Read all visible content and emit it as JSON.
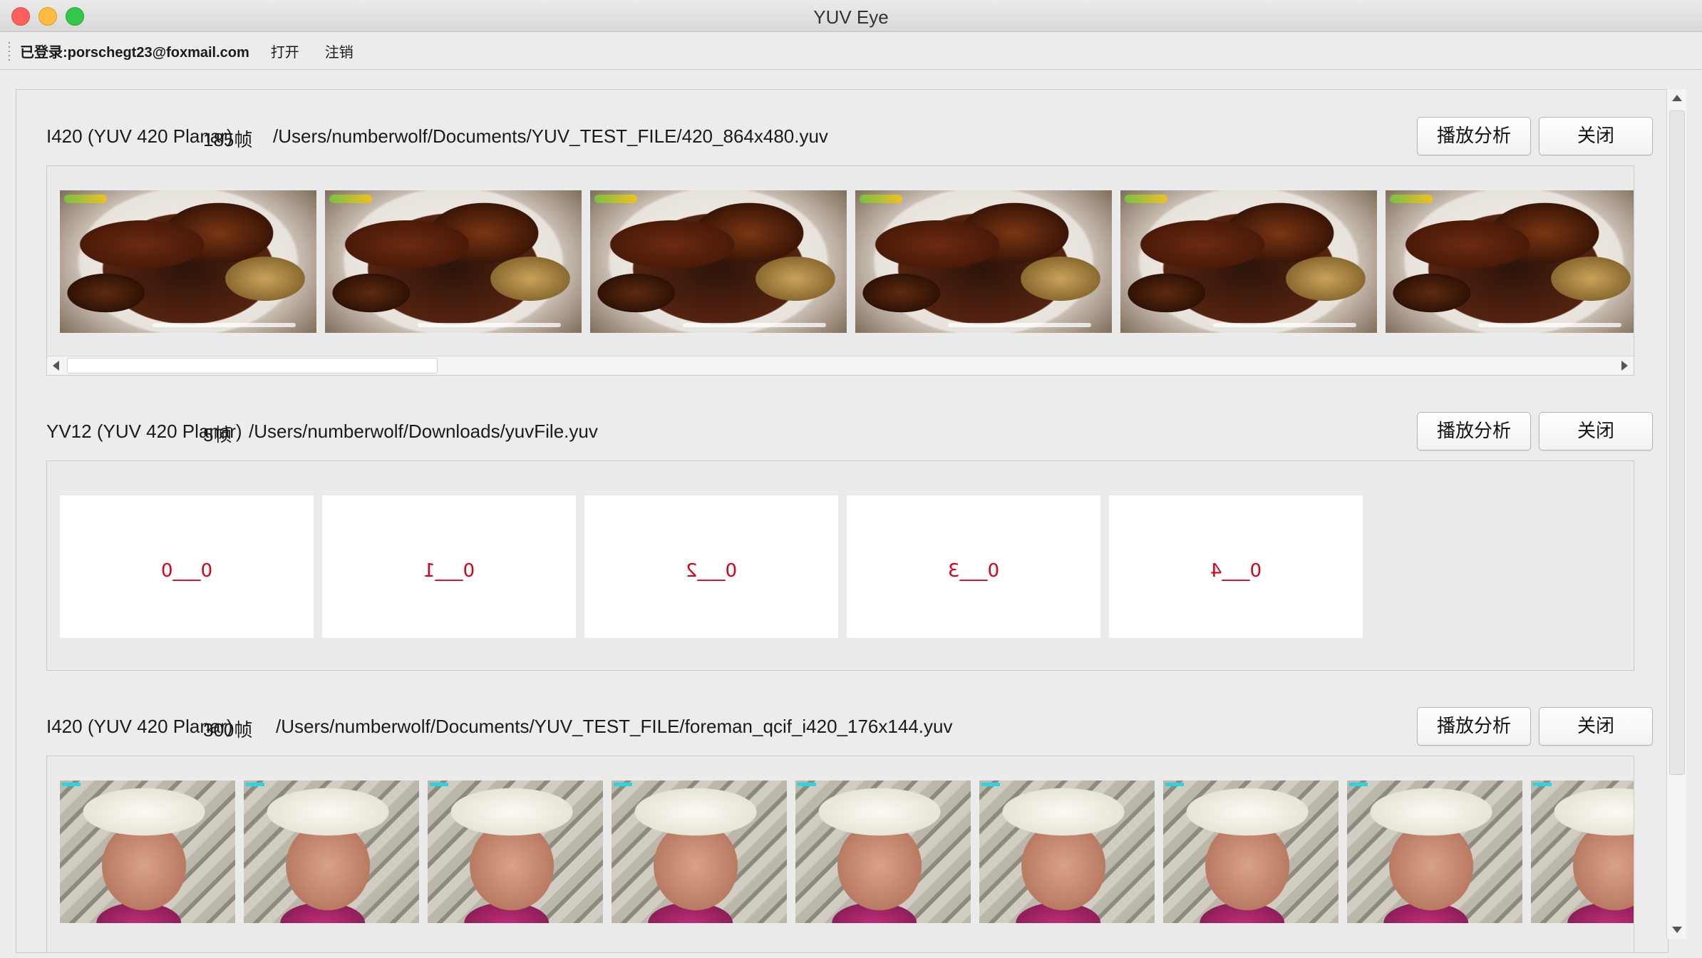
{
  "window": {
    "title": "YUV Eye"
  },
  "toolbar": {
    "login_text": "已登录:porschegt23@foxmail.com",
    "open_label": "打开",
    "logout_label": "注销"
  },
  "files": [
    {
      "format": "I420 (YUV 420 Planar)",
      "frames": "185帧",
      "path": "/Users/numberwolf/Documents/YUV_TEST_FILE/420_864x480.yuv",
      "play_label": "播放分析",
      "close_label": "关闭",
      "thumb_kind": "food-dish-frame"
    },
    {
      "format": "YV12 (YUV 420 Planar)",
      "frames": "5帧",
      "path": "/Users/numberwolf/Downloads/yuvFile.yuv",
      "play_label": "播放分析",
      "close_label": "关闭",
      "thumb_labels": [
        "0___0",
        "0___1",
        "0___2",
        "0___3",
        "0___4"
      ]
    },
    {
      "format": "I420 (YUV 420 Planar)",
      "frames": "300帧",
      "path": "/Users/numberwolf/Documents/YUV_TEST_FILE/foreman_qcif_i420_176x144.yuv",
      "play_label": "播放分析",
      "close_label": "关闭",
      "thumb_kind": "foreman-face-frame"
    }
  ],
  "colors": {
    "frame_label_red": "#d9001b",
    "window_bg": "#ececec"
  }
}
